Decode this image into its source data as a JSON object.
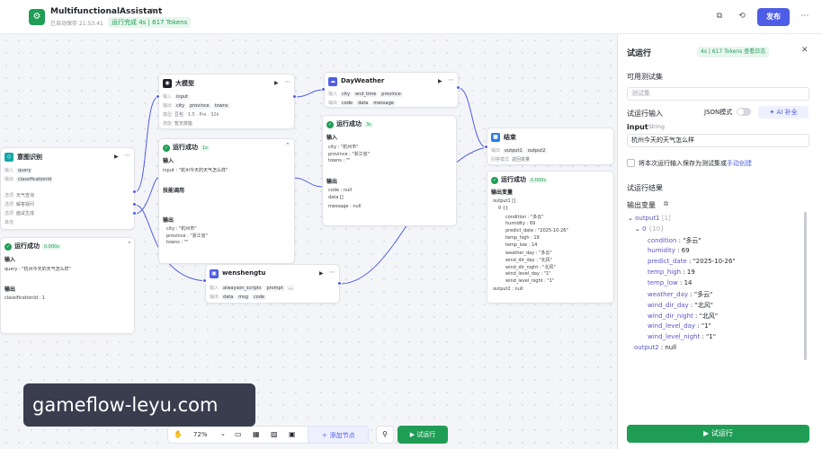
{
  "app": {
    "title": "MultifunctionalAssistant",
    "autosave": "已自动保存 21:53:41",
    "run_badge": "运行完成 4s | 617 Tokens",
    "publish": "发布"
  },
  "nodes": {
    "llm": {
      "title": "大模型",
      "in_label": "输入",
      "in_value": "input",
      "out_label": "输出",
      "out_chips": [
        "city",
        "province",
        "towns"
      ],
      "model_label": "模型",
      "model_value": "豆包 · 1.5 · Pro · 32k",
      "skill_label": "技能",
      "skill_value": "暂无技能",
      "ok": "运行成功",
      "ok_time": "1s",
      "input_sec": "输入",
      "input_kv": "input : \"杭州今天的天气怎么样\"",
      "skill_sec": "技能调用",
      "output_sec": "输出",
      "out_kv": [
        "city : \"杭州市\"",
        "province : \"浙江省\"",
        "towns : \"\""
      ]
    },
    "weather": {
      "title": "DayWeather",
      "in_label": "输入",
      "in_chips": [
        "city",
        "end_time",
        "province"
      ],
      "out_label": "输出",
      "out_chips": [
        "code",
        "data",
        "message"
      ],
      "ok": "运行成功",
      "ok_time": "3s",
      "input_sec": "输入",
      "in_kv": [
        "city : \"杭州市\"",
        "province : \"浙江省\"",
        "towns : \"\""
      ],
      "output_sec": "输出",
      "out_kv": [
        "code : null",
        "data []",
        "message : null"
      ]
    },
    "intent": {
      "title": "意图识别",
      "in_label": "输入",
      "in_value": "query",
      "out_label": "输出",
      "out_value": "classificationId",
      "options_label": [
        "选项",
        "选项",
        "选项",
        "其他"
      ],
      "options": [
        "天气查询",
        "解答疑问",
        "面试生成"
      ],
      "ok": "运行成功",
      "ok_time": "0.000s",
      "input_sec": "输入",
      "in_kv": "query : \"杭州今天的天气怎么样\"",
      "output_sec": "输出",
      "out_kv": "classificationId : 1"
    },
    "wenshengtu": {
      "title": "wenshengtu",
      "in_label": "输入",
      "in_chips": [
        "alwayson_scripts",
        "prompt",
        "..."
      ],
      "out_label": "输出",
      "out_chips": [
        "data",
        "msg",
        "code"
      ]
    },
    "end": {
      "title": "结束",
      "out_label": "输出",
      "out_chips": [
        "output1",
        "output2"
      ],
      "mode_label": "回答模式",
      "mode_value": "返回变量",
      "ok": "运行成功",
      "ok_time": "0.000s",
      "output_sec": "输出变量",
      "kv": [
        "output1 []",
        "0 {}",
        "condition : \"多云\"",
        "humidity : 69",
        "predict_date : \"2025-10-26\"",
        "temp_high : 19",
        "temp_low : 14",
        "weather_day : \"多云\"",
        "wind_dir_day : \"北风\"",
        "wind_dir_night : \"北风\"",
        "wind_level_day : \"1\"",
        "wind_level_night : \"1\"",
        "output2 : null"
      ]
    }
  },
  "toolbar": {
    "zoom": "72%",
    "add_node": "添加节点",
    "test_run": "试运行"
  },
  "watermark": "gameflow-leyu.com",
  "panel": {
    "title": "试运行",
    "badge": "4s | 617 Tokens  查看日志",
    "testset_label": "可用测试集",
    "testset_placeholder": "测试集",
    "input_label": "试运行输入",
    "json_mode": "JSON模式",
    "ai_fill": "AI 补全",
    "input_name": "input",
    "input_type": "String",
    "input_value": "杭州今天的天气怎么样",
    "save_text": "将本次运行输入保存为测试集或",
    "save_link": "手动创建",
    "result_label": "试运行结果",
    "output_var_label": "输出变量",
    "tree": [
      {
        "k": "output1",
        "v": "[1]"
      },
      {
        "k": "0",
        "v": "{10}"
      },
      {
        "k": "condition",
        "v": "\"多云\""
      },
      {
        "k": "humidity",
        "v": "69"
      },
      {
        "k": "predict_date",
        "v": "\"2025-10-26\""
      },
      {
        "k": "temp_high",
        "v": "19"
      },
      {
        "k": "temp_low",
        "v": "14"
      },
      {
        "k": "weather_day",
        "v": "\"多云\""
      },
      {
        "k": "wind_dir_day",
        "v": "\"北风\""
      },
      {
        "k": "wind_dir_night",
        "v": "\"北风\""
      },
      {
        "k": "wind_level_day",
        "v": "\"1\""
      },
      {
        "k": "wind_level_night",
        "v": "\"1\""
      },
      {
        "k": "output2",
        "v": "null"
      }
    ],
    "run_button": "试运行"
  }
}
